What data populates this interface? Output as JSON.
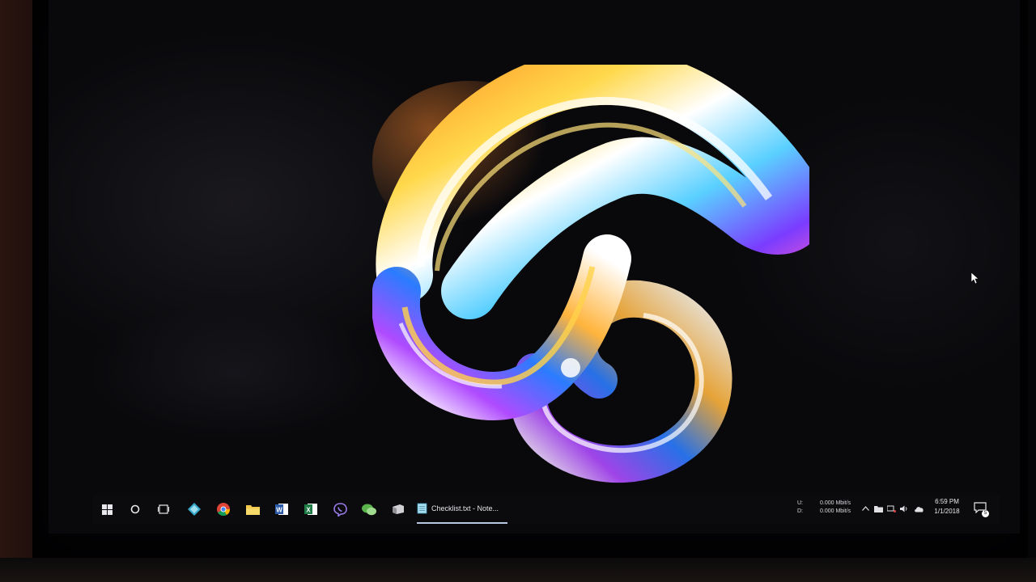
{
  "taskbar": {
    "items": [
      {
        "name": "start-button",
        "icon": "windows-logo-icon"
      },
      {
        "name": "search-button",
        "icon": "cortana-circle-icon"
      },
      {
        "name": "task-view-button",
        "icon": "task-view-icon"
      },
      {
        "name": "app-pinned-1",
        "icon": "diamond-app-icon"
      },
      {
        "name": "chrome-button",
        "icon": "chrome-icon"
      },
      {
        "name": "file-explorer-button",
        "icon": "folder-icon"
      },
      {
        "name": "word-button",
        "icon": "word-icon"
      },
      {
        "name": "excel-button",
        "icon": "excel-icon"
      },
      {
        "name": "viber-button",
        "icon": "viber-icon"
      },
      {
        "name": "wechat-button",
        "icon": "wechat-icon"
      },
      {
        "name": "app-pinned-2",
        "icon": "box-app-icon"
      }
    ],
    "active_app": {
      "label": "Checklist.txt - Note...",
      "icon": "notepad-icon"
    }
  },
  "tray": {
    "net_upload_label": "U:",
    "net_upload_value": "0.000 Mbit/s",
    "net_download_label": "D:",
    "net_download_value": "0.000 Mbit/s",
    "overflow_icon": "chevron-up-icon",
    "icons": [
      "folder-icon",
      "network-icon",
      "volume-icon",
      "cloud-icon"
    ],
    "time": "6:59 PM",
    "date": "1/1/2018",
    "notification_count": "5"
  },
  "colors": {
    "accent_underline": "#b8c8e0",
    "excel_green": "#1d7a45",
    "word_blue": "#2b5aa8",
    "viber_purple": "#7b55c8",
    "wechat_green": "#5ab34b"
  }
}
